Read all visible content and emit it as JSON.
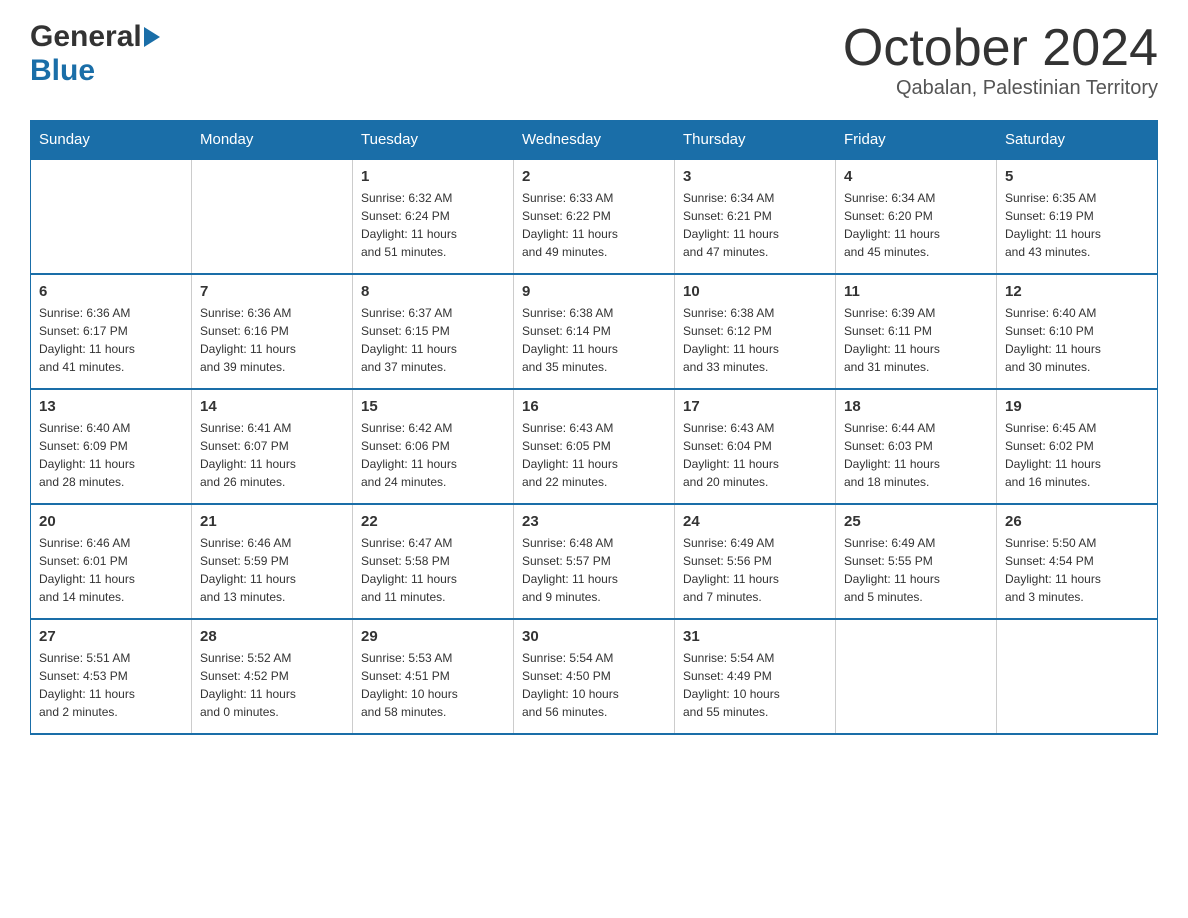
{
  "header": {
    "logo_general": "General",
    "logo_blue": "Blue",
    "month_year": "October 2024",
    "location": "Qabalan, Palestinian Territory"
  },
  "days_of_week": [
    "Sunday",
    "Monday",
    "Tuesday",
    "Wednesday",
    "Thursday",
    "Friday",
    "Saturday"
  ],
  "weeks": [
    [
      {
        "day": "",
        "info": ""
      },
      {
        "day": "",
        "info": ""
      },
      {
        "day": "1",
        "info": "Sunrise: 6:32 AM\nSunset: 6:24 PM\nDaylight: 11 hours\nand 51 minutes."
      },
      {
        "day": "2",
        "info": "Sunrise: 6:33 AM\nSunset: 6:22 PM\nDaylight: 11 hours\nand 49 minutes."
      },
      {
        "day": "3",
        "info": "Sunrise: 6:34 AM\nSunset: 6:21 PM\nDaylight: 11 hours\nand 47 minutes."
      },
      {
        "day": "4",
        "info": "Sunrise: 6:34 AM\nSunset: 6:20 PM\nDaylight: 11 hours\nand 45 minutes."
      },
      {
        "day": "5",
        "info": "Sunrise: 6:35 AM\nSunset: 6:19 PM\nDaylight: 11 hours\nand 43 minutes."
      }
    ],
    [
      {
        "day": "6",
        "info": "Sunrise: 6:36 AM\nSunset: 6:17 PM\nDaylight: 11 hours\nand 41 minutes."
      },
      {
        "day": "7",
        "info": "Sunrise: 6:36 AM\nSunset: 6:16 PM\nDaylight: 11 hours\nand 39 minutes."
      },
      {
        "day": "8",
        "info": "Sunrise: 6:37 AM\nSunset: 6:15 PM\nDaylight: 11 hours\nand 37 minutes."
      },
      {
        "day": "9",
        "info": "Sunrise: 6:38 AM\nSunset: 6:14 PM\nDaylight: 11 hours\nand 35 minutes."
      },
      {
        "day": "10",
        "info": "Sunrise: 6:38 AM\nSunset: 6:12 PM\nDaylight: 11 hours\nand 33 minutes."
      },
      {
        "day": "11",
        "info": "Sunrise: 6:39 AM\nSunset: 6:11 PM\nDaylight: 11 hours\nand 31 minutes."
      },
      {
        "day": "12",
        "info": "Sunrise: 6:40 AM\nSunset: 6:10 PM\nDaylight: 11 hours\nand 30 minutes."
      }
    ],
    [
      {
        "day": "13",
        "info": "Sunrise: 6:40 AM\nSunset: 6:09 PM\nDaylight: 11 hours\nand 28 minutes."
      },
      {
        "day": "14",
        "info": "Sunrise: 6:41 AM\nSunset: 6:07 PM\nDaylight: 11 hours\nand 26 minutes."
      },
      {
        "day": "15",
        "info": "Sunrise: 6:42 AM\nSunset: 6:06 PM\nDaylight: 11 hours\nand 24 minutes."
      },
      {
        "day": "16",
        "info": "Sunrise: 6:43 AM\nSunset: 6:05 PM\nDaylight: 11 hours\nand 22 minutes."
      },
      {
        "day": "17",
        "info": "Sunrise: 6:43 AM\nSunset: 6:04 PM\nDaylight: 11 hours\nand 20 minutes."
      },
      {
        "day": "18",
        "info": "Sunrise: 6:44 AM\nSunset: 6:03 PM\nDaylight: 11 hours\nand 18 minutes."
      },
      {
        "day": "19",
        "info": "Sunrise: 6:45 AM\nSunset: 6:02 PM\nDaylight: 11 hours\nand 16 minutes."
      }
    ],
    [
      {
        "day": "20",
        "info": "Sunrise: 6:46 AM\nSunset: 6:01 PM\nDaylight: 11 hours\nand 14 minutes."
      },
      {
        "day": "21",
        "info": "Sunrise: 6:46 AM\nSunset: 5:59 PM\nDaylight: 11 hours\nand 13 minutes."
      },
      {
        "day": "22",
        "info": "Sunrise: 6:47 AM\nSunset: 5:58 PM\nDaylight: 11 hours\nand 11 minutes."
      },
      {
        "day": "23",
        "info": "Sunrise: 6:48 AM\nSunset: 5:57 PM\nDaylight: 11 hours\nand 9 minutes."
      },
      {
        "day": "24",
        "info": "Sunrise: 6:49 AM\nSunset: 5:56 PM\nDaylight: 11 hours\nand 7 minutes."
      },
      {
        "day": "25",
        "info": "Sunrise: 6:49 AM\nSunset: 5:55 PM\nDaylight: 11 hours\nand 5 minutes."
      },
      {
        "day": "26",
        "info": "Sunrise: 5:50 AM\nSunset: 4:54 PM\nDaylight: 11 hours\nand 3 minutes."
      }
    ],
    [
      {
        "day": "27",
        "info": "Sunrise: 5:51 AM\nSunset: 4:53 PM\nDaylight: 11 hours\nand 2 minutes."
      },
      {
        "day": "28",
        "info": "Sunrise: 5:52 AM\nSunset: 4:52 PM\nDaylight: 11 hours\nand 0 minutes."
      },
      {
        "day": "29",
        "info": "Sunrise: 5:53 AM\nSunset: 4:51 PM\nDaylight: 10 hours\nand 58 minutes."
      },
      {
        "day": "30",
        "info": "Sunrise: 5:54 AM\nSunset: 4:50 PM\nDaylight: 10 hours\nand 56 minutes."
      },
      {
        "day": "31",
        "info": "Sunrise: 5:54 AM\nSunset: 4:49 PM\nDaylight: 10 hours\nand 55 minutes."
      },
      {
        "day": "",
        "info": ""
      },
      {
        "day": "",
        "info": ""
      }
    ]
  ]
}
